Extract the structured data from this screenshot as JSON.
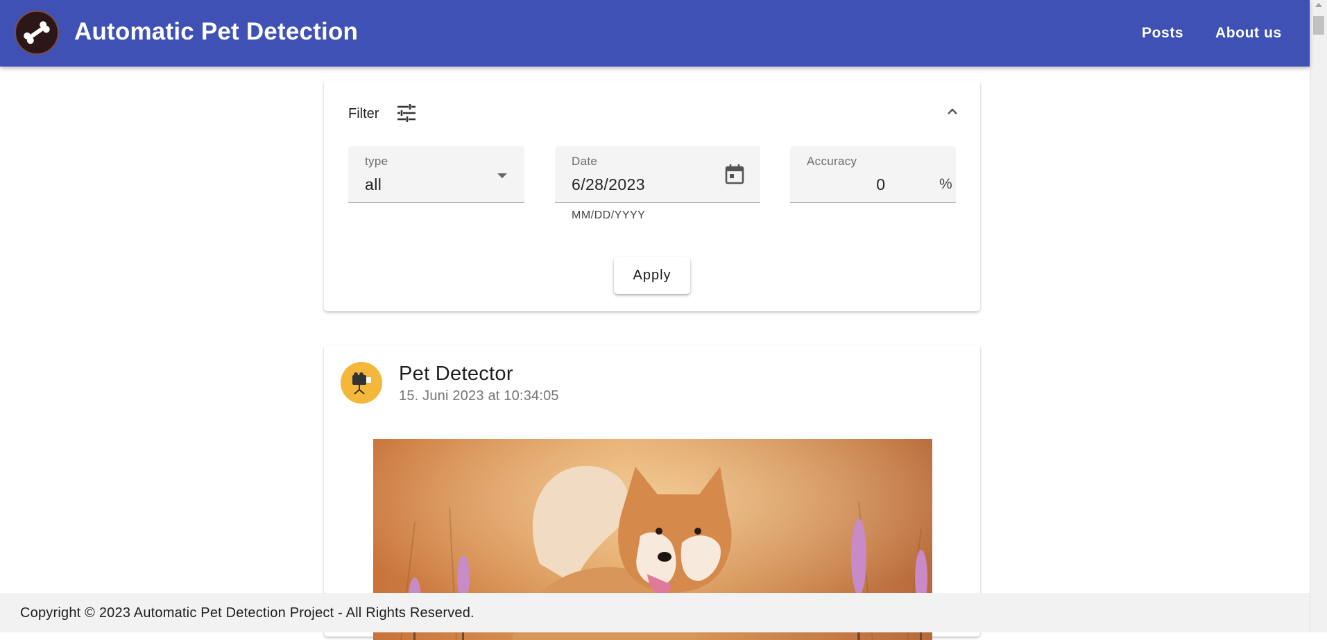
{
  "header": {
    "title": "Automatic Pet Detection",
    "logo_icon": "bone-icon",
    "nav": [
      {
        "label": "Posts"
      },
      {
        "label": "About us"
      }
    ],
    "color": "#3f51b5"
  },
  "filter": {
    "label": "Filter",
    "filter_icon": "tune-icon",
    "collapse_icon": "chevron-up-icon",
    "type_field": {
      "label": "type",
      "value": "all"
    },
    "date_field": {
      "label": "Date",
      "value": "6/28/2023",
      "helper": "MM/DD/YYYY",
      "icon": "calendar-icon"
    },
    "accuracy_field": {
      "label": "Accuracy",
      "value": "0",
      "suffix": "%"
    },
    "apply_label": "Apply"
  },
  "post": {
    "author": "Pet Detector",
    "date": "15. Juni 2023 at 10:34:05",
    "avatar_icon": "video-camera-icon",
    "avatar_color": "#f4b73a"
  },
  "footer": {
    "text": "Copyright © 2023 Automatic Pet Detection Project - All Rights Reserved."
  }
}
